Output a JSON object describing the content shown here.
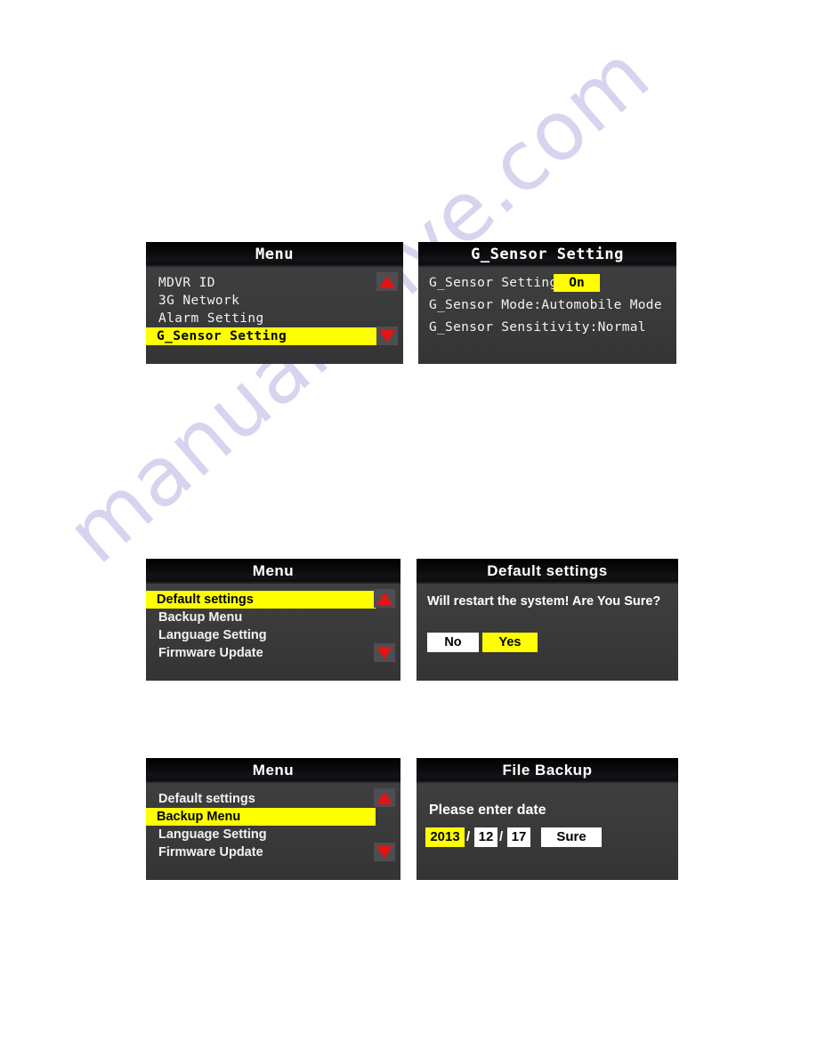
{
  "page": {
    "background_color": "#ffffff",
    "watermark_text": "manualshive.com",
    "watermark_color": "#4a42b8"
  },
  "colors": {
    "screen_background": "#3a3a3a",
    "title_background": "#0a0a0c",
    "highlight_yellow": "#ffff00",
    "arrow_red": "#e71212",
    "text_white": "#f2f2f2"
  },
  "screens": [
    {
      "id": "menu-gsensor",
      "title": "Menu",
      "type": "menu",
      "items": [
        {
          "label": "MDVR ID",
          "selected": false
        },
        {
          "label": "3G Network",
          "selected": false
        },
        {
          "label": "Alarm Setting",
          "selected": false
        },
        {
          "label": "G_Sensor Setting",
          "selected": true
        }
      ],
      "scroll_up_icon": "triangle-up-icon",
      "scroll_down_icon": "triangle-down-icon"
    },
    {
      "id": "gsensor-setting",
      "title": "G_Sensor Setting",
      "type": "settings",
      "rows": [
        {
          "label": "G_Sensor Setting",
          "value": "On",
          "highlighted": true
        },
        {
          "label": "G_Sensor Mode:Automobile Mode",
          "value": "",
          "highlighted": false
        },
        {
          "label": "G_Sensor Sensitivity:Normal",
          "value": "",
          "highlighted": false
        }
      ]
    },
    {
      "id": "menu-default",
      "title": "Menu",
      "type": "menu",
      "items": [
        {
          "label": "Default settings",
          "selected": true
        },
        {
          "label": "Backup Menu",
          "selected": false
        },
        {
          "label": "Language Setting",
          "selected": false
        },
        {
          "label": "Firmware Update",
          "selected": false
        }
      ],
      "scroll_up_icon": "triangle-up-icon",
      "scroll_down_icon": "triangle-down-icon"
    },
    {
      "id": "default-settings-dialog",
      "title": "Default settings",
      "type": "dialog",
      "message": "Will restart the system! Are You Sure?",
      "buttons": [
        {
          "label": "No",
          "style": "white"
        },
        {
          "label": "Yes",
          "style": "yellow"
        }
      ]
    },
    {
      "id": "menu-backup",
      "title": "Menu",
      "type": "menu",
      "items": [
        {
          "label": "Default settings",
          "selected": false
        },
        {
          "label": "Backup Menu",
          "selected": true
        },
        {
          "label": "Language Setting",
          "selected": false
        },
        {
          "label": "Firmware Update",
          "selected": false
        }
      ],
      "scroll_up_icon": "triangle-up-icon",
      "scroll_down_icon": "triangle-down-icon"
    },
    {
      "id": "file-backup",
      "title": "File Backup",
      "type": "backup",
      "prompt": "Please enter date",
      "date": {
        "year": "2013",
        "month": "12",
        "day": "17",
        "separator": "/",
        "focused_field": "year"
      },
      "confirm_label": "Sure"
    }
  ]
}
